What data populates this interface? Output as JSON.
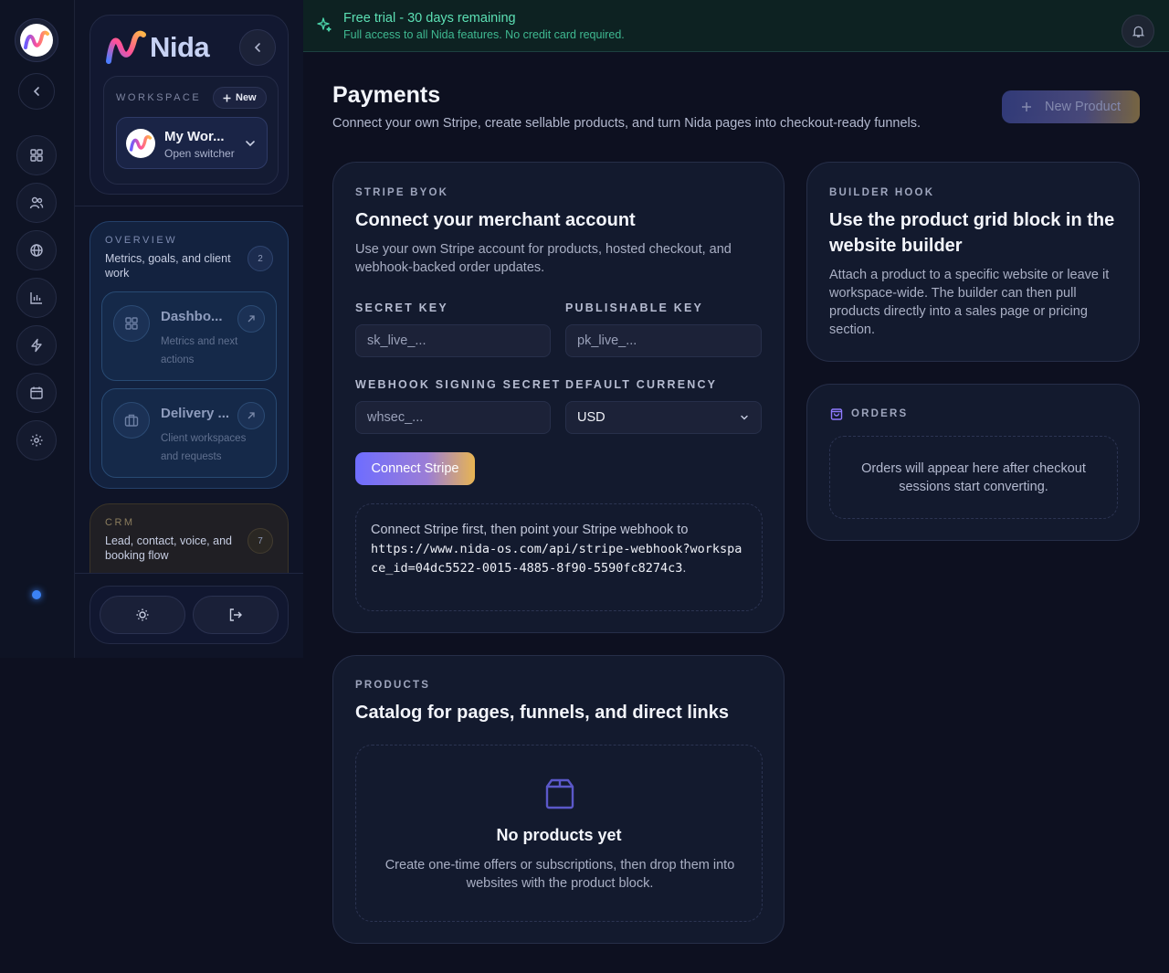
{
  "banner": {
    "title": "Free trial - 30 days remaining",
    "subtitle": "Full access to all Nida features. No credit card required."
  },
  "brand": {
    "name": "Nida"
  },
  "workspace": {
    "label": "WORKSPACE",
    "new_label": "New",
    "name": "My Wor...",
    "switcher_hint": "Open switcher"
  },
  "nav_groups": [
    {
      "label": "OVERVIEW",
      "description": "Metrics, goals, and client work",
      "count": "2",
      "items": [
        {
          "title": "Dashbo...",
          "description": "Metrics and next actions"
        },
        {
          "title": "Delivery ...",
          "description": "Client workspaces and requests"
        }
      ]
    },
    {
      "label": "CRM",
      "description": "Lead, contact, voice, and booking flow",
      "count": "7"
    }
  ],
  "page": {
    "title": "Payments",
    "subtitle": "Connect your own Stripe, create sellable products, and turn Nida pages into checkout-ready funnels.",
    "new_product_label": "New Product"
  },
  "stripe": {
    "eyebrow": "STRIPE BYOK",
    "title": "Connect your merchant account",
    "description": "Use your own Stripe account for products, hosted checkout, and webhook-backed order updates.",
    "secret_key_label": "SECRET KEY",
    "secret_key_placeholder": "sk_live_...",
    "publishable_key_label": "PUBLISHABLE KEY",
    "publishable_key_placeholder": "pk_live_...",
    "webhook_label": "WEBHOOK SIGNING SECRET",
    "webhook_placeholder": "whsec_...",
    "currency_label": "DEFAULT CURRENCY",
    "currency_value": "USD",
    "connect_label": "Connect Stripe",
    "webhook_hint": "Connect Stripe first, then point your Stripe webhook to",
    "webhook_url": "https://www.nida-os.com/api/stripe-webhook?workspace_id=04dc5522-0015-4885-8f90-5590fc8274c3",
    "webhook_period": "."
  },
  "builder": {
    "eyebrow": "BUILDER HOOK",
    "title": "Use the product grid block in the website builder",
    "description": "Attach a product to a specific website or leave it workspace-wide. The builder can then pull products directly into a sales page or pricing section."
  },
  "orders": {
    "eyebrow": "ORDERS",
    "empty": "Orders will appear here after checkout sessions start converting."
  },
  "products": {
    "eyebrow": "PRODUCTS",
    "title": "Catalog for pages, funnels, and direct links",
    "empty_title": "No products yet",
    "empty_desc": "Create one-time offers or subscriptions, then drop them into websites with the product block."
  },
  "colors": {
    "accent_start": "#6e6dff",
    "accent_end": "#e8b552",
    "trial_green": "#5ce0b4"
  }
}
